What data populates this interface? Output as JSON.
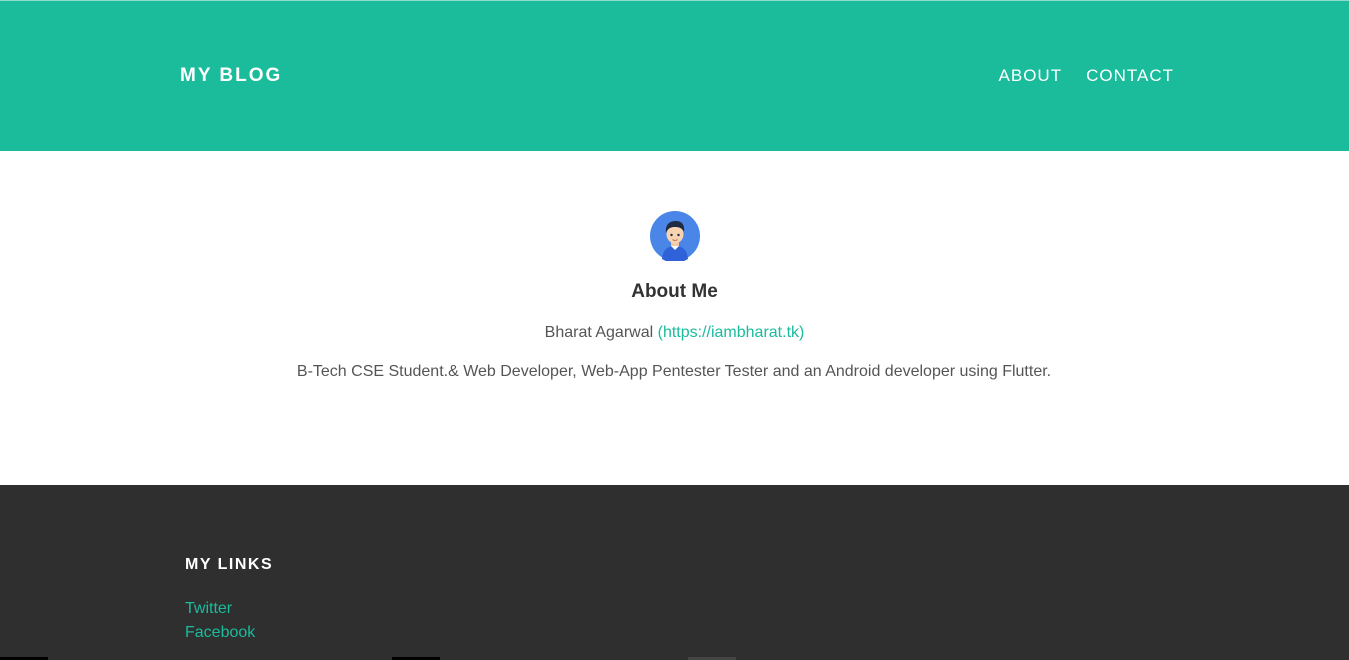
{
  "navbar": {
    "brand": "MY BLOG",
    "links": [
      "ABOUT",
      "CONTACT"
    ],
    "color": "#1abc9c"
  },
  "about": {
    "avatar_icon": "user-avatar-icon",
    "title": "About Me",
    "author_name": "Bharat Agarwal",
    "author_link": "(https://iambharat.tk)",
    "bio": "B-Tech CSE Student.& Web Developer, Web-App Pentester Tester and an Android developer using Flutter."
  },
  "footer": {
    "heading": "MY LINKS",
    "links": [
      "Twitter",
      "Facebook"
    ],
    "background": "#2f2f2f"
  }
}
